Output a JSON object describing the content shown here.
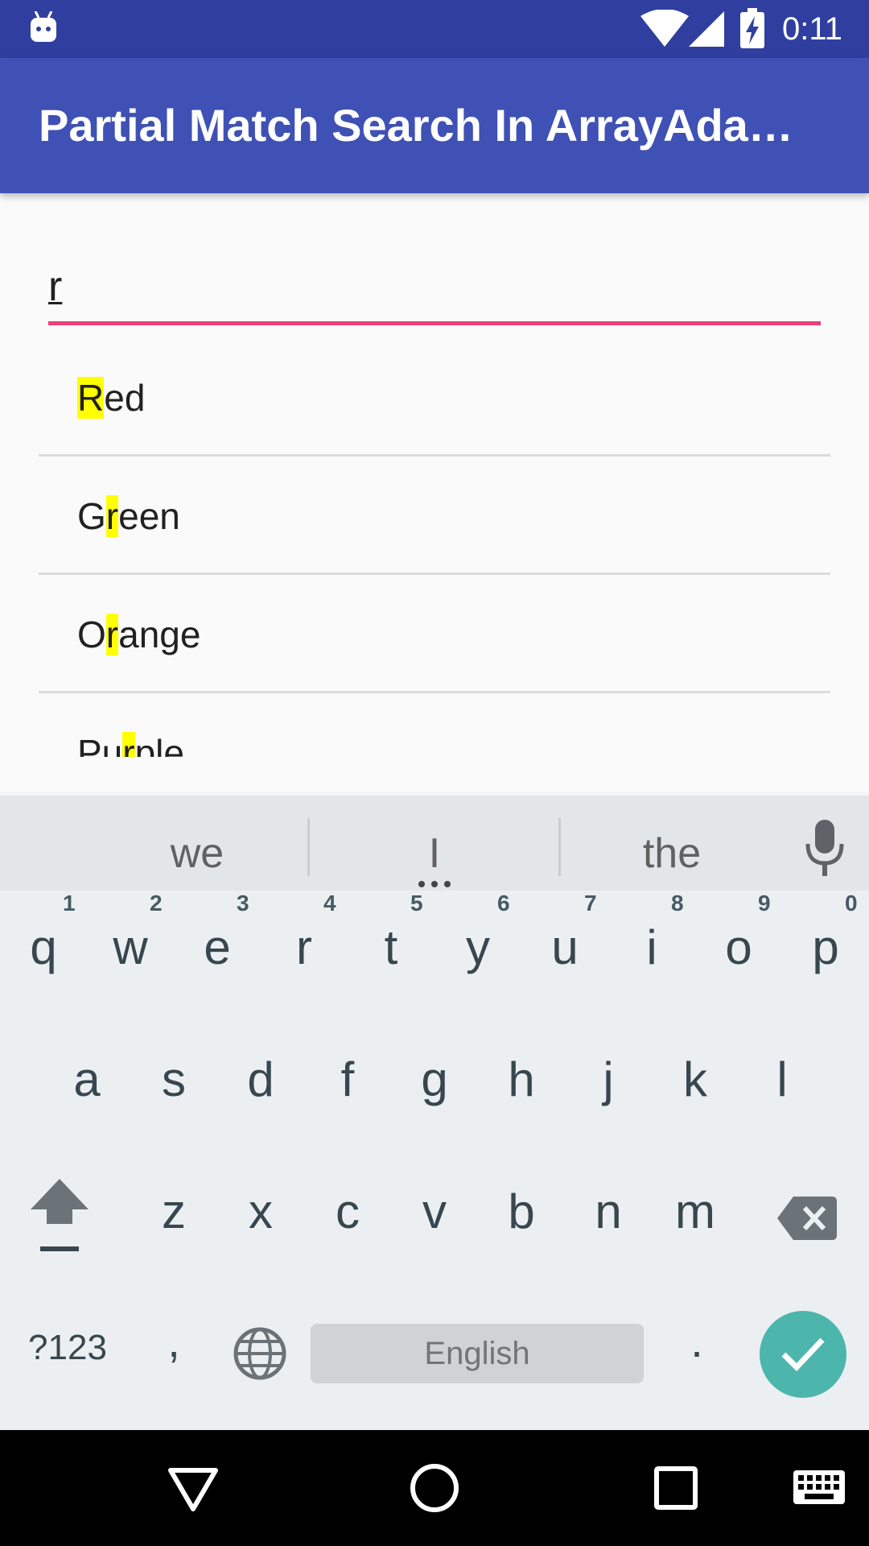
{
  "status_bar": {
    "time": "0:11",
    "icons": [
      "android-debug-icon",
      "wifi-icon",
      "signal-icon",
      "battery-charging-icon"
    ]
  },
  "app_bar": {
    "title": "Partial Match Search In ArrayAda…"
  },
  "search": {
    "value": "r"
  },
  "results": [
    {
      "before": "",
      "match": "R",
      "after": "ed"
    },
    {
      "before": "G",
      "match": "r",
      "after": "een"
    },
    {
      "before": "O",
      "match": "r",
      "after": "ange"
    },
    {
      "before": "Pu",
      "match": "r",
      "after": "ple"
    }
  ],
  "keyboard": {
    "suggestions": [
      "we",
      "I",
      "the"
    ],
    "row1": [
      {
        "key": "q",
        "hint": "1"
      },
      {
        "key": "w",
        "hint": "2"
      },
      {
        "key": "e",
        "hint": "3"
      },
      {
        "key": "r",
        "hint": "4"
      },
      {
        "key": "t",
        "hint": "5"
      },
      {
        "key": "y",
        "hint": "6"
      },
      {
        "key": "u",
        "hint": "7"
      },
      {
        "key": "i",
        "hint": "8"
      },
      {
        "key": "o",
        "hint": "9"
      },
      {
        "key": "p",
        "hint": "0"
      }
    ],
    "row2": [
      "a",
      "s",
      "d",
      "f",
      "g",
      "h",
      "j",
      "k",
      "l"
    ],
    "row3": [
      "z",
      "x",
      "c",
      "v",
      "b",
      "n",
      "m"
    ],
    "symbols_label": "?123",
    "comma": ",",
    "period": ".",
    "space_label": "English"
  },
  "colors": {
    "status_bar": "#303f9f",
    "app_bar": "#3f51b5",
    "accent": "#ec407a",
    "highlight": "#ffff00",
    "enter": "#4db6ac"
  }
}
